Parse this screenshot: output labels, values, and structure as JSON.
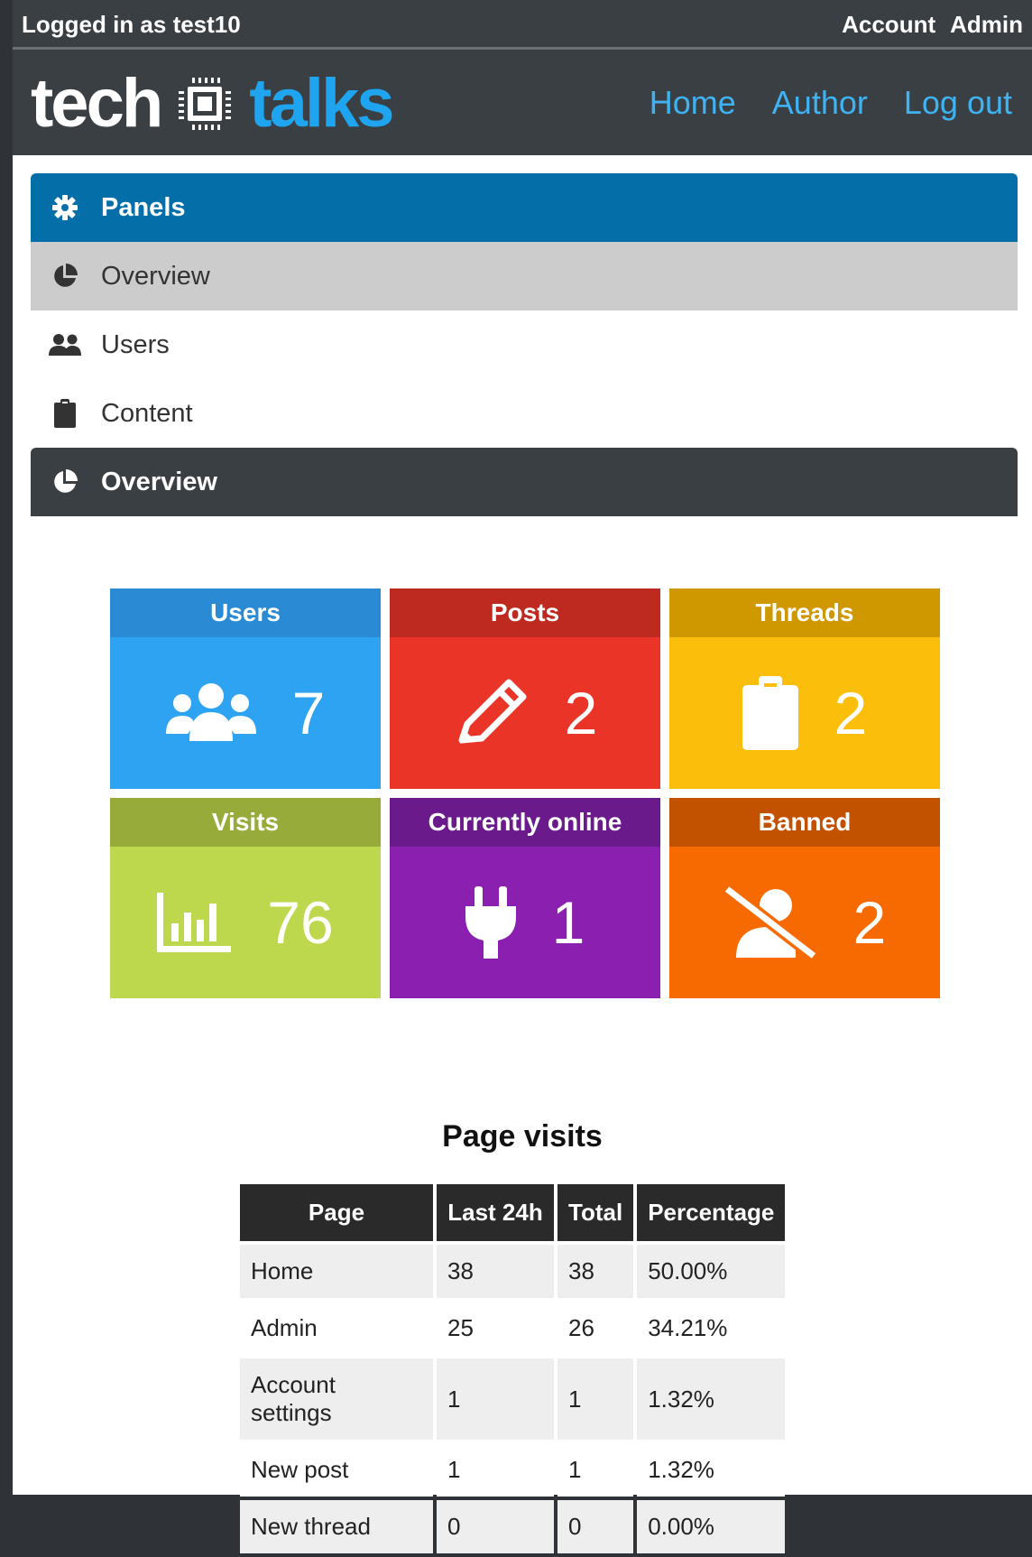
{
  "topbar": {
    "login_text": "Logged in as test10",
    "account": "Account",
    "admin": "Admin"
  },
  "header": {
    "logo_word1": "tech",
    "logo_word2": "talks",
    "nav": [
      "Home",
      "Author",
      "Log out"
    ],
    "nav_color": "#3fb3f2"
  },
  "panels": {
    "title": "Panels",
    "items": [
      {
        "label": "Overview",
        "icon": "pie-chart-icon",
        "active": true
      },
      {
        "label": "Users",
        "icon": "users-icon",
        "active": false
      },
      {
        "label": "Content",
        "icon": "clipboard-icon",
        "active": false
      }
    ],
    "header_color": "#046ea8"
  },
  "overview": {
    "title": "Overview",
    "tiles": [
      {
        "label": "Users",
        "value": "7",
        "icon": "users-icon",
        "head_color": "#2a8ad4",
        "body_color": "#2ea3f2"
      },
      {
        "label": "Posts",
        "value": "2",
        "icon": "pencil-icon",
        "head_color": "#be2920",
        "body_color": "#ea3428"
      },
      {
        "label": "Threads",
        "value": "2",
        "icon": "clipboard-icon",
        "head_color": "#cf9800",
        "body_color": "#fbbe0a"
      },
      {
        "label": "Visits",
        "value": "76",
        "icon": "bar-chart-icon",
        "head_color": "#97ab3a",
        "body_color": "#bdd84c"
      },
      {
        "label": "Currently online",
        "value": "1",
        "icon": "plug-icon",
        "head_color": "#6a1a8a",
        "body_color": "#8a1fb0"
      },
      {
        "label": "Banned",
        "value": "2",
        "icon": "user-slash-icon",
        "head_color": "#c25100",
        "body_color": "#f76a02"
      }
    ]
  },
  "page_visits": {
    "title": "Page visits",
    "columns": [
      "Page",
      "Last 24h",
      "Total",
      "Percentage"
    ],
    "rows": [
      [
        "Home",
        "38",
        "38",
        "50.00%"
      ],
      [
        "Admin",
        "25",
        "26",
        "34.21%"
      ],
      [
        "Account settings",
        "1",
        "1",
        "1.32%"
      ],
      [
        "New post",
        "1",
        "1",
        "1.32%"
      ],
      [
        "New thread",
        "0",
        "0",
        "0.00%"
      ]
    ]
  }
}
